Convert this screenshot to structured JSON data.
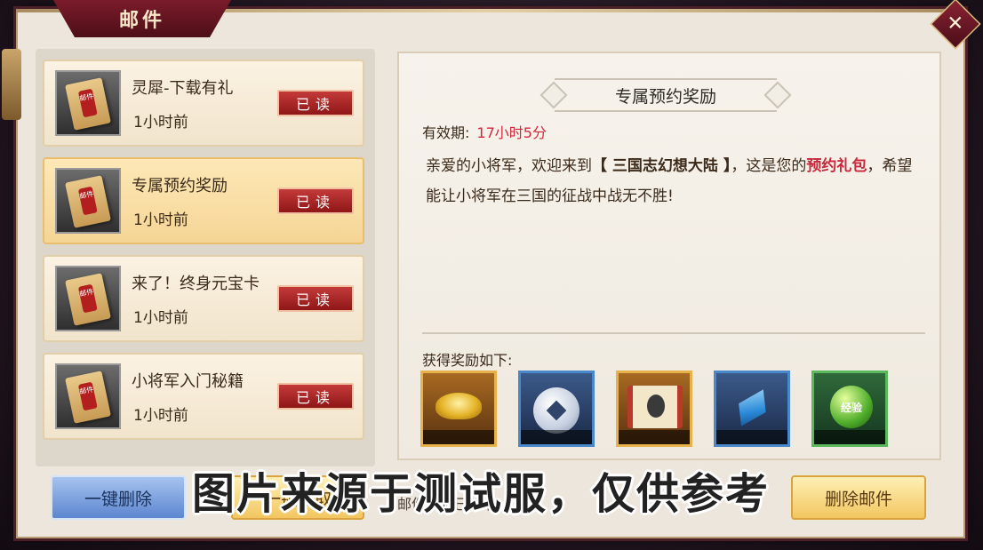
{
  "window": {
    "title": "邮件",
    "close_glyph": "✕"
  },
  "mail_list": [
    {
      "title": "灵犀-下载有礼",
      "time": "1小时前",
      "status": "已读",
      "selected": false
    },
    {
      "title": "专属预约奖励",
      "time": "1小时前",
      "status": "已读",
      "selected": true
    },
    {
      "title": "来了！终身元宝卡",
      "time": "1小时前",
      "status": "已读",
      "selected": false
    },
    {
      "title": "小将军入门秘籍",
      "time": "1小时前",
      "status": "已读",
      "selected": false
    }
  ],
  "mail_icon_seal": "邮件",
  "detail": {
    "heading": "专属预约奖励",
    "validity_label": "有效期:",
    "validity_value": "17小时5分",
    "body_part1": "亲爱的小将军，欢迎来到",
    "body_game": "【 三国志幻想大陆 】",
    "body_part2": "，这是您的",
    "body_highlight": "预约礼包",
    "body_part3": "，希望能让小将军在三国的征战中战无不胜!",
    "rewards_label": "获得奖励如下:",
    "rewards": [
      {
        "icon": "gold-ingot-icon",
        "frame_color": "#e8b24b"
      },
      {
        "icon": "silver-coin-icon",
        "frame_color": "#4a88cc"
      },
      {
        "icon": "scroll-icon",
        "frame_color": "#e8b24b"
      },
      {
        "icon": "crystal-icon",
        "frame_color": "#4a88cc"
      },
      {
        "icon": "exp-orb-icon",
        "frame_color": "#5cb85c",
        "label": "经验"
      }
    ]
  },
  "buttons": {
    "delete_all": "一键删除",
    "claim": "一键领取",
    "center_text": "邮件奖励已领取",
    "delete_mail": "删除邮件"
  },
  "watermark": "图片来源于测试服，仅供参考"
}
